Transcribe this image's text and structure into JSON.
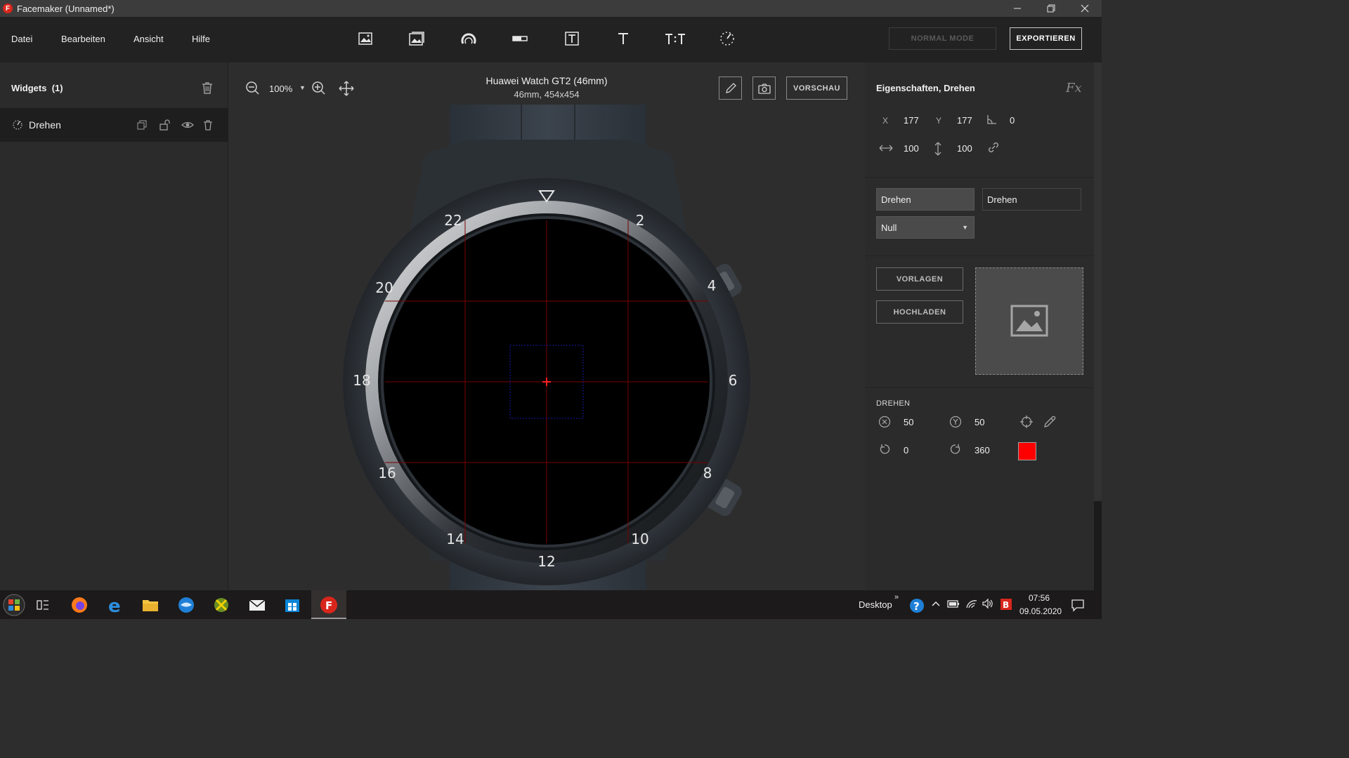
{
  "window": {
    "title": "Facemaker (Unnamed*)",
    "logo_letter": "F"
  },
  "menu": {
    "file": "Datei",
    "edit": "Bearbeiten",
    "view": "Ansicht",
    "help": "Hilfe"
  },
  "toolbar": {
    "tools": [
      "image-icon",
      "image-gallery-icon",
      "gauge-icon",
      "progress-bar-icon",
      "text-box-icon",
      "text-icon",
      "time-text-icon",
      "rotate-icon"
    ],
    "mode_label": "NORMAL MODE",
    "export_label": "EXPORTIEREN"
  },
  "left_panel": {
    "title": "Widgets",
    "count": "(1)",
    "widgets": [
      {
        "name": "Drehen"
      }
    ]
  },
  "canvas": {
    "zoom": "100%",
    "device_name": "Huawei Watch GT2 (46mm)",
    "device_resolution": "46mm, 454x454",
    "preview_label": "VORSCHAU",
    "bezel_numbers": [
      "2",
      "4",
      "6",
      "8",
      "10",
      "12",
      "14",
      "16",
      "18",
      "20",
      "22"
    ]
  },
  "right_panel": {
    "title": "Eigenschaften, Drehen",
    "fx_label": "Fx",
    "x_label": "X",
    "x": "177",
    "y_label": "Y",
    "y": "177",
    "angle": "0",
    "width": "100",
    "height": "100",
    "name_left": "Drehen",
    "name_right": "Drehen",
    "dropdown": "Null",
    "templates_label": "VORLAGEN",
    "upload_label": "HOCHLADEN",
    "rotate_section": "DREHEN",
    "pivot_x": "50",
    "pivot_y": "50",
    "start_angle": "0",
    "end_angle": "360",
    "color": "#ff0000"
  },
  "taskbar": {
    "desktop_label": "Desktop",
    "time": "07:56",
    "date": "09.05.2020"
  },
  "colors": {
    "accent": "#d9261c",
    "grid": "#8b0000",
    "selection": "#1a1aa6"
  }
}
